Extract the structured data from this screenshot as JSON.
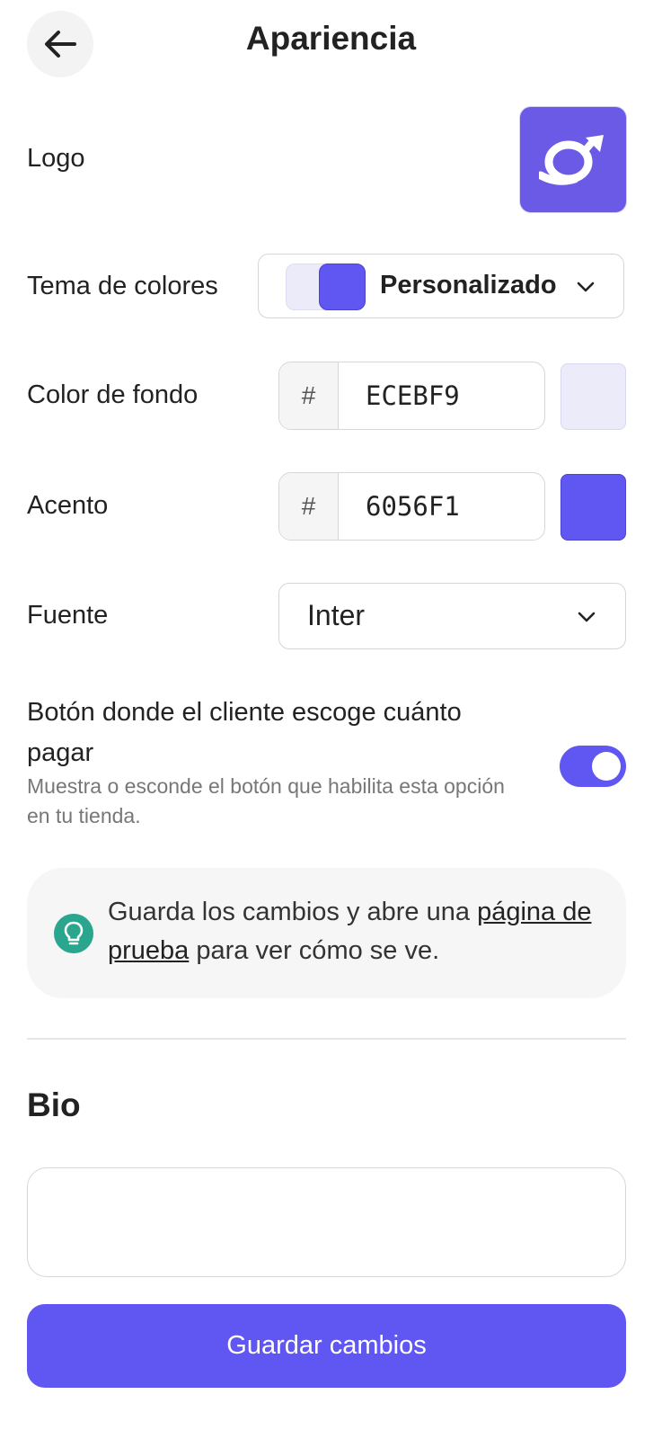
{
  "header": {
    "title": "Apariencia",
    "back_icon": "arrow-left-icon"
  },
  "logo": {
    "label": "Logo",
    "icon": "logo-arrow-loop-icon",
    "background_color": "#6A5AE5"
  },
  "theme": {
    "label": "Tema de colores",
    "value": "Personalizado",
    "swatches": [
      "#ECEBF9",
      "#6056F1"
    ]
  },
  "background_color": {
    "label": "Color de fondo",
    "prefix": "#",
    "value": "ECEBF9",
    "preview_color": "#ECEBF9"
  },
  "accent": {
    "label": "Acento",
    "prefix": "#",
    "value": "6056F1",
    "preview_color": "#6056F1"
  },
  "font": {
    "label": "Fuente",
    "value": "Inter"
  },
  "pay_what_you_want": {
    "title": "Botón donde el cliente escoge cuánto pagar",
    "description": "Muestra o esconde el botón que habilita esta opción en tu tienda.",
    "enabled": true
  },
  "tip": {
    "icon": "lightbulb-icon",
    "text_before": "Guarda los cambios y abre una ",
    "link": "página de prueba",
    "text_after": " para ver cómo se ve."
  },
  "bio": {
    "title": "Bio",
    "value": ""
  },
  "save_button": {
    "label": "Guardar cambios"
  },
  "colors": {
    "accent": "#6056F1",
    "tip_icon": "#2AA58E"
  }
}
